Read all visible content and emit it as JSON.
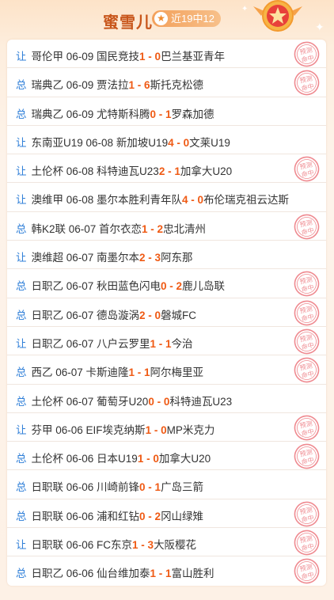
{
  "header": {
    "title": "蜜雪儿",
    "record": "近19中12"
  },
  "stamp_text": [
    "预测",
    "命中"
  ],
  "colors": {
    "accent": "#ef5a14",
    "type": "#2f7fd8",
    "stamp": "#ef8a90",
    "title": "#c8561b"
  },
  "rows": [
    {
      "type": "让",
      "league": "哥伦甲",
      "date": "06-09",
      "home": "国民竞技",
      "hs": "1",
      "as": "0",
      "away": "巴兰基亚青年",
      "hit": true
    },
    {
      "type": "总",
      "league": "瑞典乙",
      "date": "06-09",
      "home": "贾法拉",
      "hs": "1",
      "as": "6",
      "away": "斯托克松德",
      "hit": true
    },
    {
      "type": "总",
      "league": "瑞典乙",
      "date": "06-09",
      "home": "尤特斯科腾",
      "hs": "0",
      "as": "1",
      "away": "罗森加德",
      "hit": false
    },
    {
      "type": "让",
      "league": "东南亚U19",
      "date": "06-08",
      "home": "新加坡U19",
      "hs": "4",
      "as": "0",
      "away": "文莱U19",
      "hit": false
    },
    {
      "type": "让",
      "league": "土伦杯",
      "date": "06-08",
      "home": "科特迪瓦U23",
      "hs": "2",
      "as": "1",
      "away": "加拿大U20",
      "hit": true
    },
    {
      "type": "让",
      "league": "澳维甲",
      "date": "06-08",
      "home": "墨尔本胜利青年队",
      "hs": "4",
      "as": "0",
      "away": "布伦瑞克祖云达斯",
      "hit": false
    },
    {
      "type": "总",
      "league": "韩K2联",
      "date": "06-07",
      "home": "首尔衣恋",
      "hs": "1",
      "as": "2",
      "away": "忠北清州",
      "hit": true
    },
    {
      "type": "让",
      "league": "澳维超",
      "date": "06-07",
      "home": "南墨尔本",
      "hs": "2",
      "as": "3",
      "away": "阿东那",
      "hit": false
    },
    {
      "type": "总",
      "league": "日职乙",
      "date": "06-07",
      "home": "秋田蓝色闪电",
      "hs": "0",
      "as": "2",
      "away": "鹿儿岛联",
      "hit": true
    },
    {
      "type": "总",
      "league": "日职乙",
      "date": "06-07",
      "home": "德岛漩涡",
      "hs": "2",
      "as": "0",
      "away": "磐城FC",
      "hit": true
    },
    {
      "type": "让",
      "league": "日职乙",
      "date": "06-07",
      "home": "八户云罗里",
      "hs": "1",
      "as": "1",
      "away": "今治",
      "hit": true
    },
    {
      "type": "总",
      "league": "西乙",
      "date": "06-07",
      "home": "卡斯迪隆",
      "hs": "1",
      "as": "1",
      "away": "阿尔梅里亚",
      "hit": true
    },
    {
      "type": "总",
      "league": "土伦杯",
      "date": "06-07",
      "home": "葡萄牙U20",
      "hs": "0",
      "as": "0",
      "away": "科特迪瓦U23",
      "hit": false
    },
    {
      "type": "让",
      "league": "芬甲",
      "date": "06-06",
      "home": "EIF埃克纳斯",
      "hs": "1",
      "as": "0",
      "away": "MP米克力",
      "hit": true
    },
    {
      "type": "总",
      "league": "土伦杯",
      "date": "06-06",
      "home": "日本U19",
      "hs": "1",
      "as": "0",
      "away": "加拿大U20",
      "hit": true
    },
    {
      "type": "总",
      "league": "日职联",
      "date": "06-06",
      "home": "川崎前锋",
      "hs": "0",
      "as": "1",
      "away": "广岛三箭",
      "hit": false
    },
    {
      "type": "总",
      "league": "日职联",
      "date": "06-06",
      "home": "浦和红钻",
      "hs": "0",
      "as": "2",
      "away": "冈山绿雉",
      "hit": true
    },
    {
      "type": "让",
      "league": "日职联",
      "date": "06-06",
      "home": "FC东京",
      "hs": "1",
      "as": "3",
      "away": "大阪樱花",
      "hit": true
    },
    {
      "type": "总",
      "league": "日职乙",
      "date": "06-06",
      "home": "仙台维加泰",
      "hs": "1",
      "as": "1",
      "away": "富山胜利",
      "hit": true
    }
  ]
}
